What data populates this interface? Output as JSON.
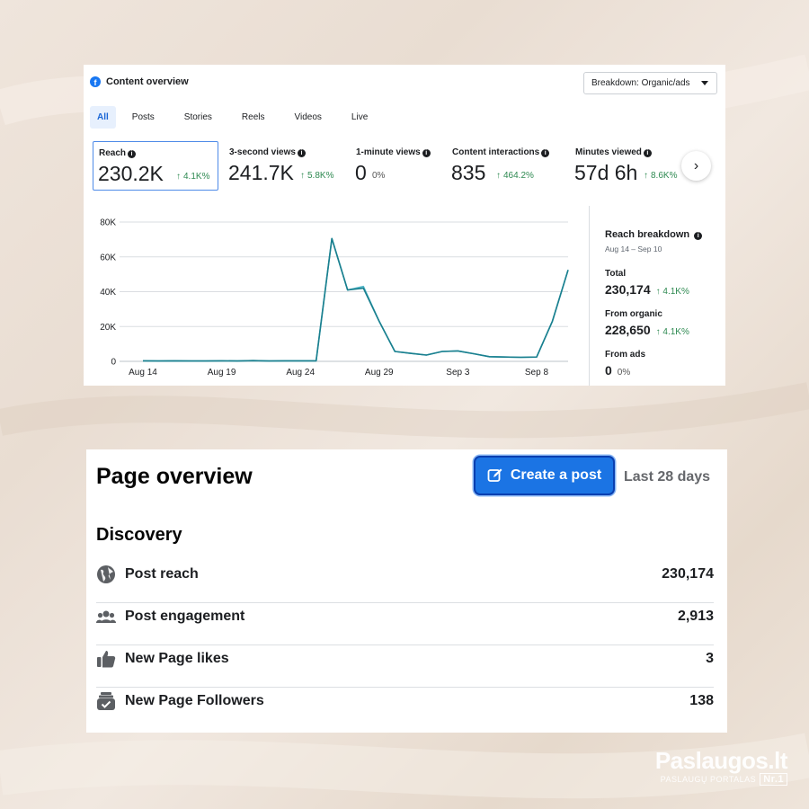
{
  "content_overview": {
    "title": "Content overview",
    "breakdown_label": "Breakdown: Organic/ads",
    "tabs": [
      "All",
      "Posts",
      "Stories",
      "Reels",
      "Videos",
      "Live"
    ],
    "active_tab": "All",
    "metrics": [
      {
        "label": "Reach",
        "value": "230.2K",
        "change": "4.1K%",
        "trend": "up"
      },
      {
        "label": "3-second views",
        "value": "241.7K",
        "change": "5.8K%",
        "trend": "up"
      },
      {
        "label": "1-minute views",
        "value": "0",
        "change": "0%",
        "trend": "none"
      },
      {
        "label": "Content interactions",
        "value": "835",
        "change": "464.2%",
        "trend": "up"
      },
      {
        "label": "Minutes viewed",
        "value": "57d 6h",
        "change": "8.6K%",
        "trend": "up"
      }
    ],
    "reach_breakdown": {
      "title": "Reach breakdown",
      "date_range": "Aug 14 – Sep 10",
      "total_label": "Total",
      "total_value": "230,174",
      "total_change": "4.1K%",
      "organic_label": "From organic",
      "organic_value": "228,650",
      "organic_change": "4.1K%",
      "ads_label": "From ads",
      "ads_value": "0",
      "ads_change": "0%"
    }
  },
  "chart_data": {
    "type": "line",
    "x": [
      "Aug 14",
      "Aug 15",
      "Aug 16",
      "Aug 17",
      "Aug 18",
      "Aug 19",
      "Aug 20",
      "Aug 21",
      "Aug 22",
      "Aug 23",
      "Aug 24",
      "Aug 25",
      "Aug 26",
      "Aug 27",
      "Aug 28",
      "Aug 29",
      "Aug 30",
      "Aug 31",
      "Sep 1",
      "Sep 2",
      "Sep 3",
      "Sep 4",
      "Sep 5",
      "Sep 6",
      "Sep 7",
      "Sep 8",
      "Sep 9",
      "Sep 10"
    ],
    "x_tick_labels": [
      "Aug 14",
      "Aug 19",
      "Aug 24",
      "Aug 29",
      "Sep 3",
      "Sep 8"
    ],
    "y_tick_labels": [
      "0",
      "20K",
      "40K",
      "60K",
      "80K"
    ],
    "ylim": [
      0,
      80000
    ],
    "series": [
      {
        "name": "Organic",
        "color": "#1a7f8e",
        "values": [
          300,
          200,
          300,
          200,
          200,
          300,
          200,
          400,
          200,
          300,
          300,
          300,
          70500,
          41000,
          42000,
          23000,
          5700,
          4600,
          3600,
          5700,
          6000,
          4400,
          2700,
          2500,
          2300,
          2500,
          23000,
          52500
        ]
      },
      {
        "name": "Total",
        "color": "#52b7c9",
        "values": [
          300,
          200,
          300,
          200,
          200,
          300,
          200,
          400,
          200,
          300,
          300,
          300,
          70500,
          41000,
          43000,
          23000,
          5700,
          4600,
          3600,
          5700,
          6000,
          4400,
          2700,
          2500,
          2300,
          2500,
          23000,
          52500
        ]
      }
    ],
    "grid": true
  },
  "page_overview": {
    "title": "Page overview",
    "create_post_label": "Create a post",
    "period_label": "Last 28 days",
    "discovery_label": "Discovery",
    "rows": [
      {
        "icon": "globe-icon",
        "label": "Post reach",
        "value": "230,174"
      },
      {
        "icon": "people-icon",
        "label": "Post engagement",
        "value": "2,913"
      },
      {
        "icon": "thumbs-up-icon",
        "label": "New Page likes",
        "value": "3"
      },
      {
        "icon": "follower-icon",
        "label": "New Page Followers",
        "value": "138"
      }
    ]
  },
  "watermark": {
    "brand": "Paslaugos.lt",
    "tagline": "PASLAUGŲ PORTALAS",
    "badge": "Nr.1"
  }
}
